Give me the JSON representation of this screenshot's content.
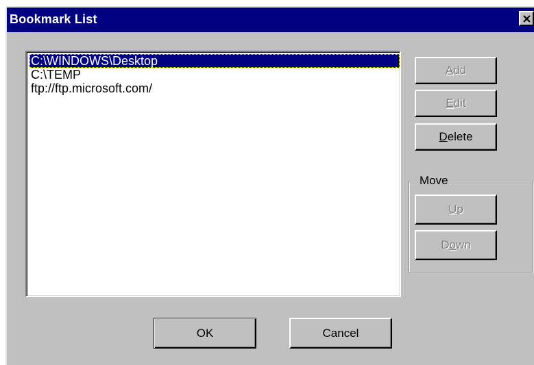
{
  "window": {
    "title": "Bookmark List"
  },
  "bookmarks": {
    "items": [
      {
        "path": "C:\\WINDOWS\\Desktop",
        "selected": true
      },
      {
        "path": "C:\\TEMP",
        "selected": false
      },
      {
        "path": "ftp://ftp.microsoft.com/",
        "selected": false
      }
    ]
  },
  "buttons": {
    "add": {
      "mnemonic": "A",
      "rest": "dd",
      "enabled": false
    },
    "edit": {
      "mnemonic": "E",
      "rest": "dit",
      "enabled": false
    },
    "delete": {
      "mnemonic": "D",
      "rest": "elete",
      "enabled": true
    },
    "ok": {
      "label": "OK"
    },
    "cancel": {
      "label": "Cancel"
    }
  },
  "move_group": {
    "title": "Move",
    "up": {
      "mnemonic": "U",
      "rest": "p",
      "enabled": false
    },
    "down": {
      "pre": "D",
      "mnemonic": "o",
      "rest": "wn",
      "enabled": false
    }
  },
  "icons": {
    "close": "close-icon"
  },
  "colors": {
    "titlebar": "#000080",
    "face": "#c0c0c0",
    "selection": "#000080"
  }
}
